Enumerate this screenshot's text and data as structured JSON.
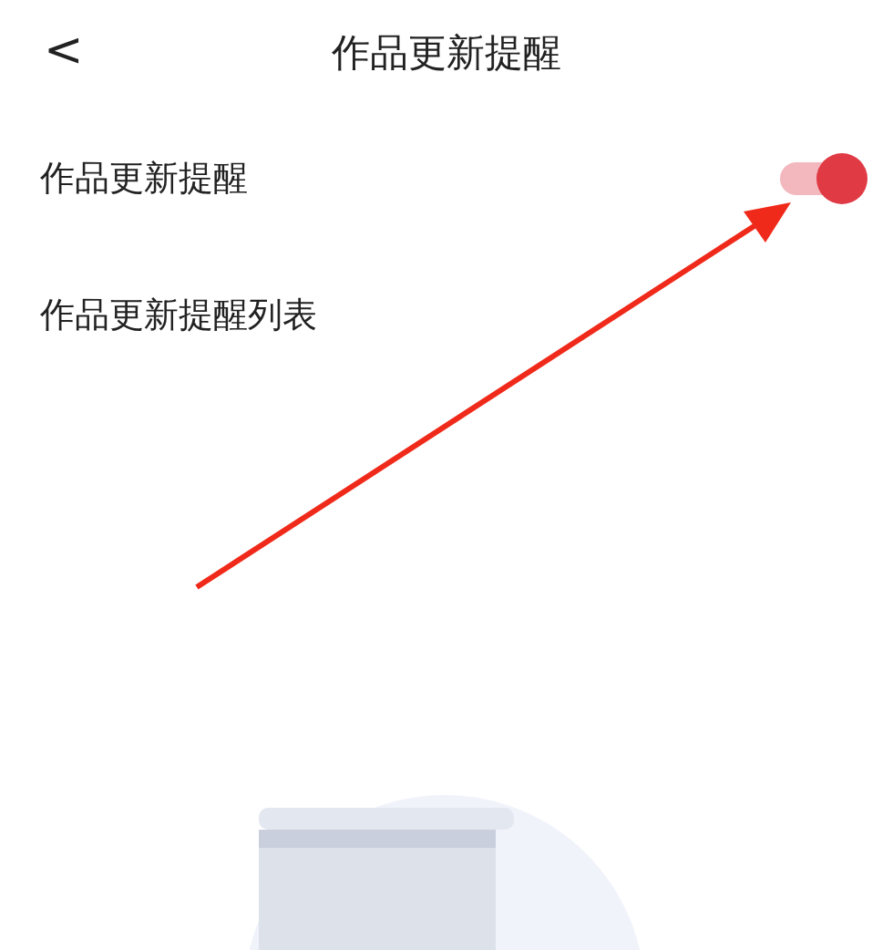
{
  "header": {
    "back": "<",
    "title": "作品更新提醒"
  },
  "settings": [
    {
      "kind": "toggle",
      "label": "作品更新提醒",
      "on": true
    },
    {
      "kind": "link",
      "label": "作品更新提醒列表"
    }
  ],
  "empty_state": {
    "kind": "illustration"
  },
  "annotations": [
    {
      "kind": "arrow"
    }
  ]
}
